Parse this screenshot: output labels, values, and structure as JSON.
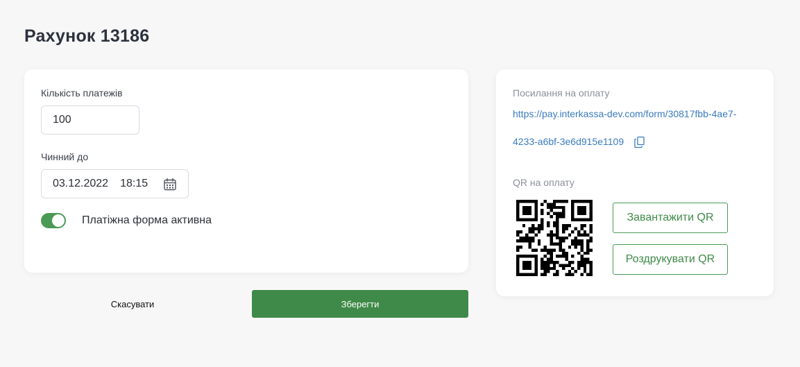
{
  "page": {
    "title": "Рахунок 13186"
  },
  "form": {
    "payments_count_label": "Кількість платежів",
    "payments_count_value": "100",
    "valid_until_label": "Чинний до",
    "valid_until_date": "03.12.2022",
    "valid_until_time": "18:15",
    "active_label": "Платіжна форма активна",
    "active": true
  },
  "actions": {
    "cancel_label": "Скасувати",
    "save_label": "Зберегти"
  },
  "payment": {
    "link_label": "Посилання на оплату",
    "link_line1": "https://pay.interkassa-dev.com/form/30817fbb-4ae7-",
    "link_line2": "4233-a6bf-3e6d915e1109",
    "qr_label": "QR на оплату",
    "download_qr_label": "Завантажити QR",
    "print_qr_label": "Роздрукувати QR"
  },
  "colors": {
    "accent_green": "#3f8a48",
    "link_blue": "#3a7bbf"
  },
  "icons": {
    "calendar": "calendar-icon",
    "copy": "copy-icon",
    "qr": "qr-code"
  }
}
